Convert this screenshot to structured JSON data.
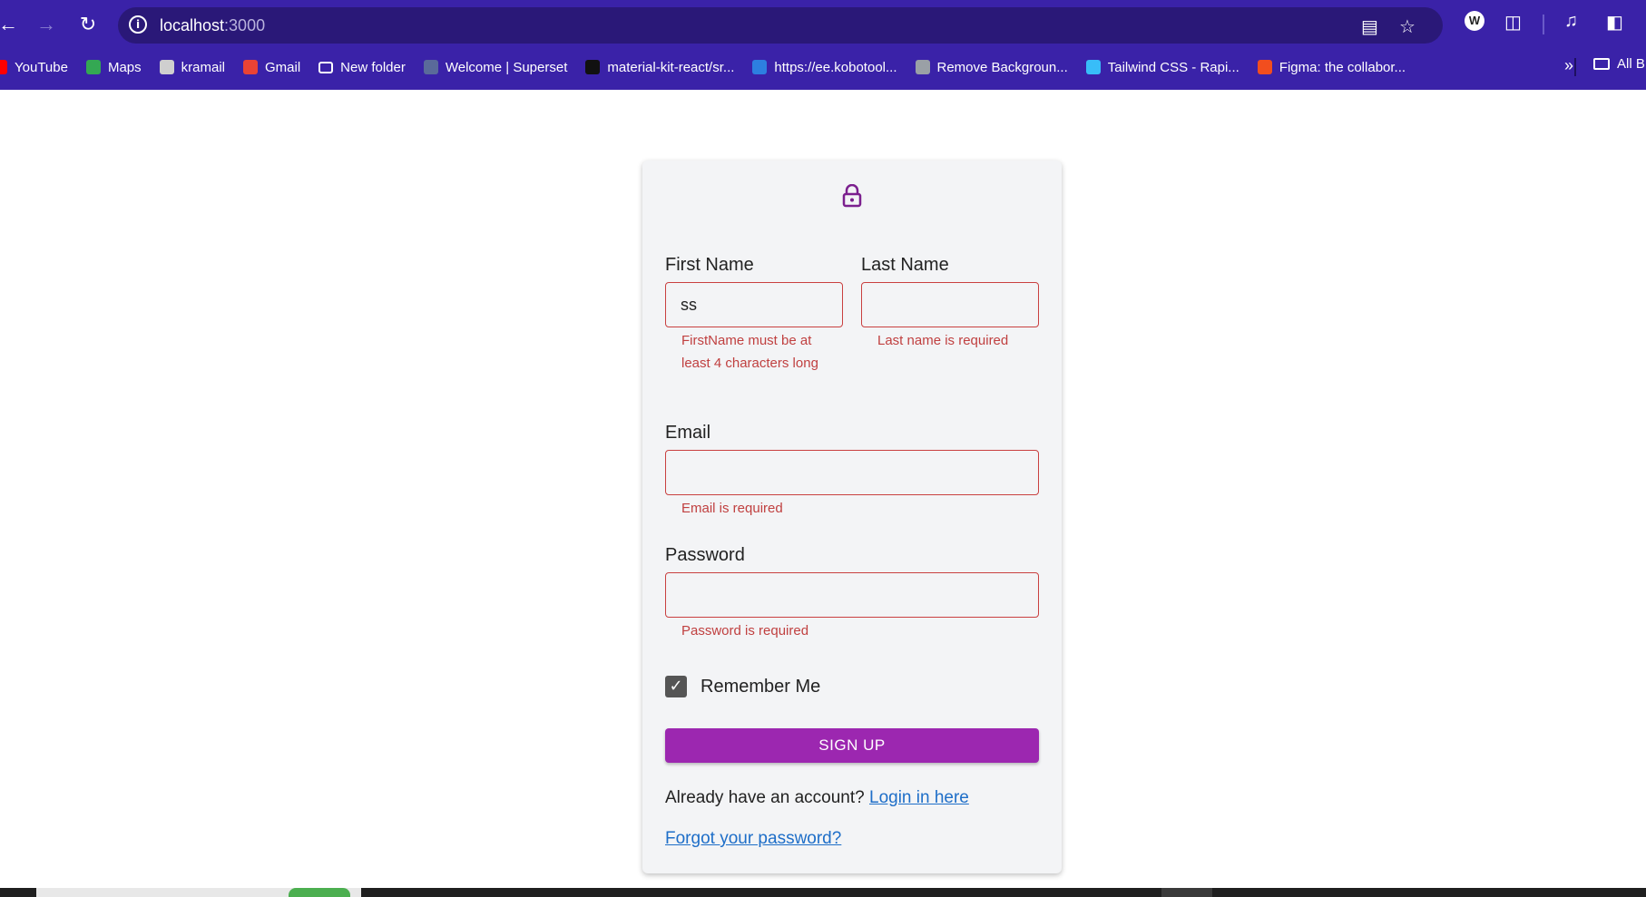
{
  "browser": {
    "url_host": "localhost",
    "url_port": ":3000",
    "bookmarks": [
      {
        "label": "YouTube",
        "color": "#ff0000"
      },
      {
        "label": "Maps",
        "color": "#34a853"
      },
      {
        "label": "kramail",
        "color": "#cfcfcf"
      },
      {
        "label": "Gmail",
        "color": "#ea4335"
      },
      {
        "label": "New folder",
        "color": ""
      },
      {
        "label": "Welcome | Superset",
        "color": "#5a6a9a"
      },
      {
        "label": "material-kit-react/sr...",
        "color": "#111111"
      },
      {
        "label": "https://ee.kobotool...",
        "color": "#2d7fe0"
      },
      {
        "label": "Remove Backgroun...",
        "color": "#9aa0a6"
      },
      {
        "label": "Tailwind CSS - Rapi...",
        "color": "#38bdf8"
      },
      {
        "label": "Figma: the collabor...",
        "color": "#f24e1e"
      }
    ],
    "all_bookmarks_label": "All B"
  },
  "form": {
    "first_name_label": "First Name",
    "first_name_value": "ss",
    "first_name_error": "FirstName must be at least 4 characters long",
    "last_name_label": "Last Name",
    "last_name_value": "",
    "last_name_error": "Last name is required",
    "email_label": "Email",
    "email_value": "",
    "email_error": "Email is required",
    "password_label": "Password",
    "password_value": "",
    "password_error": "Password is required",
    "remember_label": "Remember Me",
    "remember_checked": true,
    "submit_label": "SIGN UP",
    "have_account_text": "Already have an account?",
    "login_link": "Login in here",
    "forgot_link": "Forgot your password?"
  },
  "colors": {
    "browser_bar": "#3a22a8",
    "primary": "#9c27b0",
    "error": "#c04040",
    "link": "#1e6ec8"
  }
}
